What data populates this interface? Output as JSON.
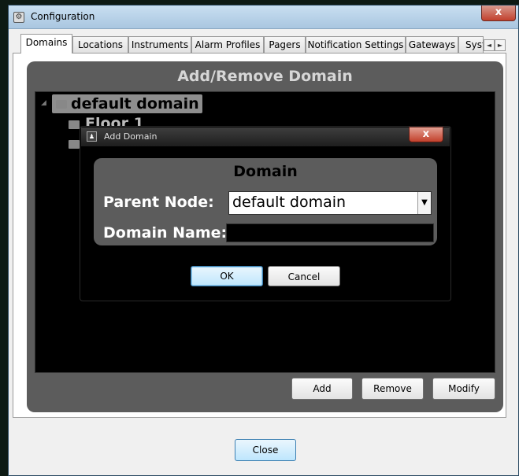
{
  "window": {
    "title": "Configuration",
    "close_glyph": "x"
  },
  "tabs": [
    {
      "label": "Domains",
      "active": true
    },
    {
      "label": "Locations"
    },
    {
      "label": "Instruments"
    },
    {
      "label": "Alarm Profiles"
    },
    {
      "label": "Pagers"
    },
    {
      "label": "Notification Settings"
    },
    {
      "label": "Gateways"
    },
    {
      "label": "Syst"
    }
  ],
  "tab_scroll": {
    "left": "◄",
    "right": "►"
  },
  "panel": {
    "title": "Add/Remove Domain",
    "tree": {
      "root": "default domain",
      "child": "Floor 1"
    },
    "buttons": {
      "add": "Add",
      "remove": "Remove",
      "modify": "Modify"
    }
  },
  "dialog": {
    "title": "Add Domain",
    "close_glyph": "x",
    "heading": "Domain",
    "parent_label": "Parent Node:",
    "parent_value": "default domain",
    "name_label": "Domain Name:",
    "name_value": "",
    "ok": "OK",
    "cancel": "Cancel"
  },
  "footer": {
    "close": "Close"
  },
  "icons": {
    "window": "gear-icon",
    "dialog": "users-icon",
    "tree_expand": "expand-icon",
    "folder": "folder-icon",
    "dropdown": "chevron-down-icon"
  }
}
